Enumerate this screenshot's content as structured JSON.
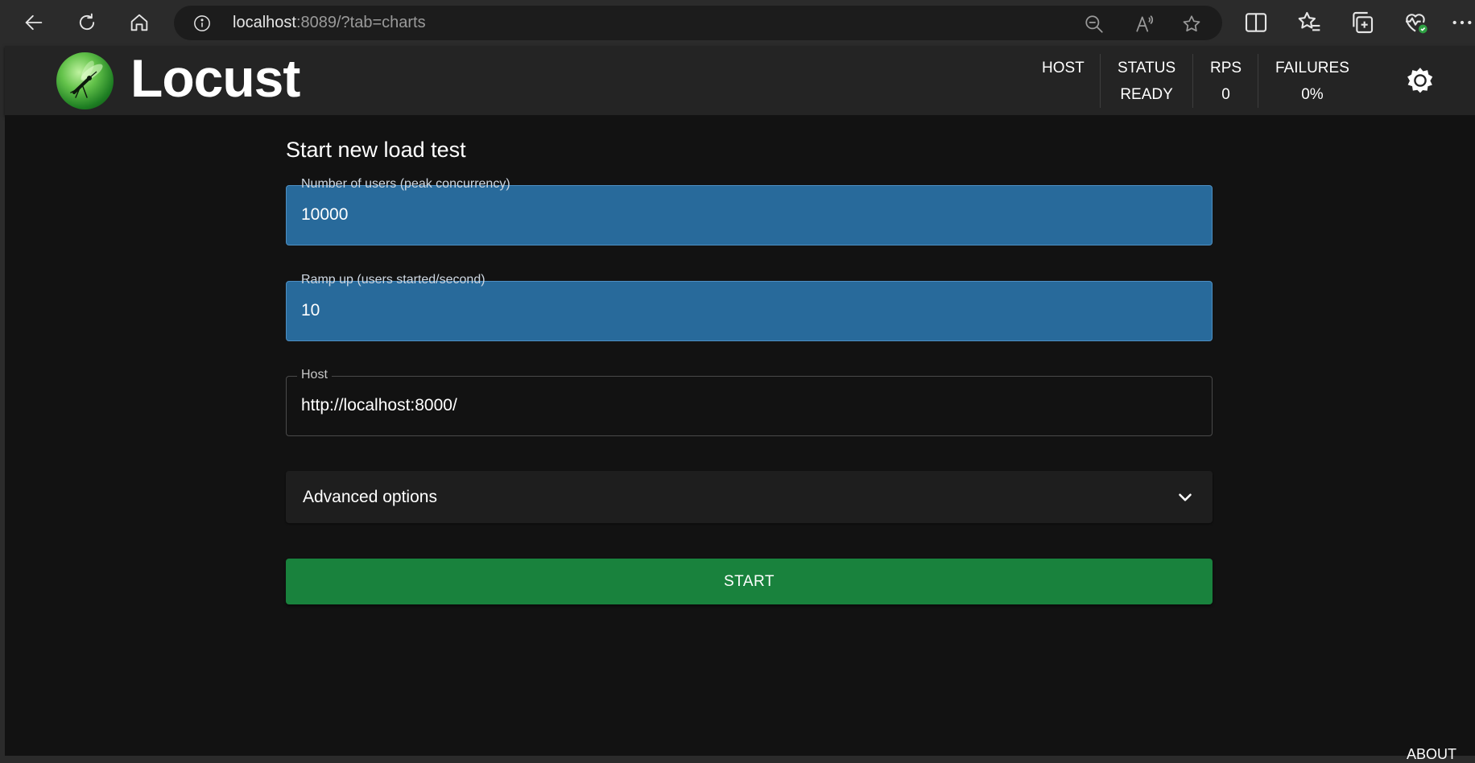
{
  "browser": {
    "url_host": "localhost",
    "url_rest": ":8089/?tab=charts"
  },
  "header": {
    "logo_text": "Locust",
    "stats": {
      "host": {
        "label": "HOST",
        "value": ""
      },
      "status": {
        "label": "STATUS",
        "value": "READY"
      },
      "rps": {
        "label": "RPS",
        "value": "0"
      },
      "failures": {
        "label": "FAILURES",
        "value": "0%"
      }
    }
  },
  "form": {
    "title": "Start new load test",
    "users": {
      "label": "Number of users (peak concurrency)",
      "value": "10000"
    },
    "ramp_up": {
      "label": "Ramp up (users started/second)",
      "value": "10"
    },
    "host": {
      "label": "Host",
      "value": "http://localhost:8000/"
    },
    "advanced_label": "Advanced options",
    "start_label": "START"
  },
  "footer": {
    "about_label": "ABOUT"
  },
  "colors": {
    "accent_field": "#286a9b",
    "start_button": "#19823d",
    "background": "#121212"
  },
  "icons": {
    "back": "arrow-left-icon",
    "reload": "reload-icon",
    "home": "home-icon",
    "info": "info-icon",
    "zoom": "zoom-out-icon",
    "read_aloud": "read-aloud-icon",
    "favorite": "star-icon",
    "split": "split-screen-icon",
    "favorites": "favorites-icon",
    "collections": "collections-icon",
    "health": "browser-essentials-icon",
    "more": "more-icon",
    "theme": "brightness-icon",
    "chevron": "chevron-down-icon"
  }
}
